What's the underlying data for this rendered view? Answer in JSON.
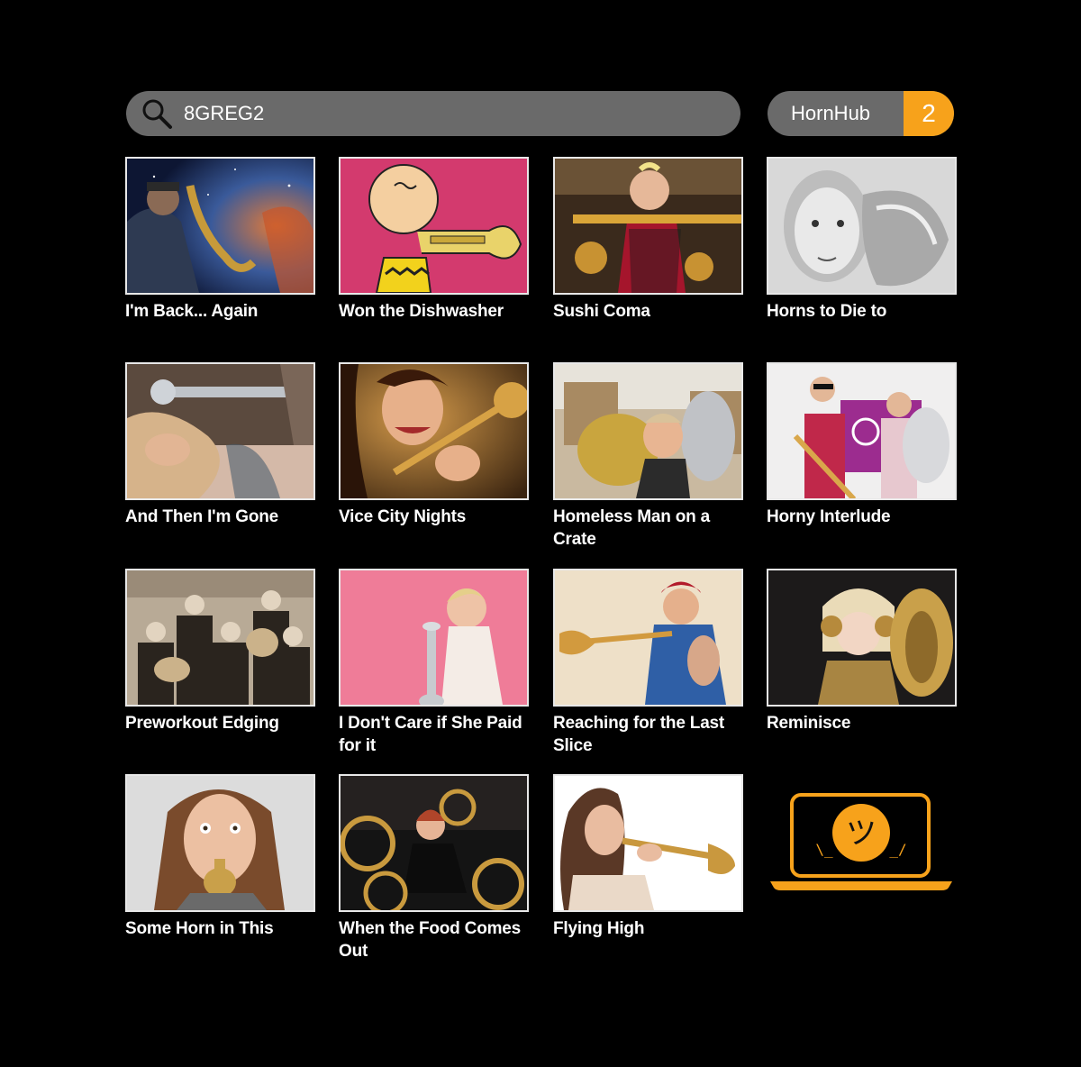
{
  "search": {
    "value": "8GREG2",
    "icon": "search-icon"
  },
  "brand": {
    "name": "HornHub",
    "badge": "2",
    "accent_color": "#f7a21b"
  },
  "videos": [
    {
      "title": "I'm Back... Again"
    },
    {
      "title": "Won the Dishwasher"
    },
    {
      "title": "Sushi Coma"
    },
    {
      "title": "Horns to Die to"
    },
    {
      "title": "And Then I'm Gone"
    },
    {
      "title": "Vice City Nights"
    },
    {
      "title": "Homeless Man on a Crate"
    },
    {
      "title": "Horny Interlude"
    },
    {
      "title": "Preworkout Edging"
    },
    {
      "title": "I Don't Care if She Paid for it"
    },
    {
      "title": "Reaching for the Last Slice"
    },
    {
      "title": "Reminisce"
    },
    {
      "title": "Some Horn in This"
    },
    {
      "title": "When the Food Comes Out"
    },
    {
      "title": "Flying High"
    }
  ],
  "placeholder": {
    "icon": "laptop-shrug-icon",
    "face": "ツ",
    "left_arm": "\\_",
    "right_arm": "_/"
  }
}
